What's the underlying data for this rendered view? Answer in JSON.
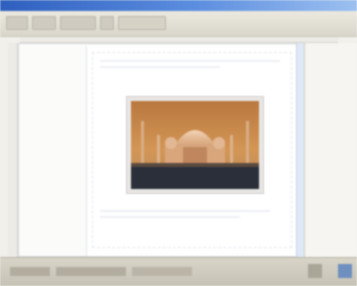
{
  "window": {
    "title": ""
  },
  "toolbar": {
    "buttons": [
      "",
      "",
      "",
      "",
      ""
    ]
  },
  "document": {
    "image": {
      "subject": "photo-taj-mahal",
      "sky_color": "#c98a4a",
      "ground_color": "#2a2f3a"
    }
  },
  "status": {
    "text": ""
  }
}
